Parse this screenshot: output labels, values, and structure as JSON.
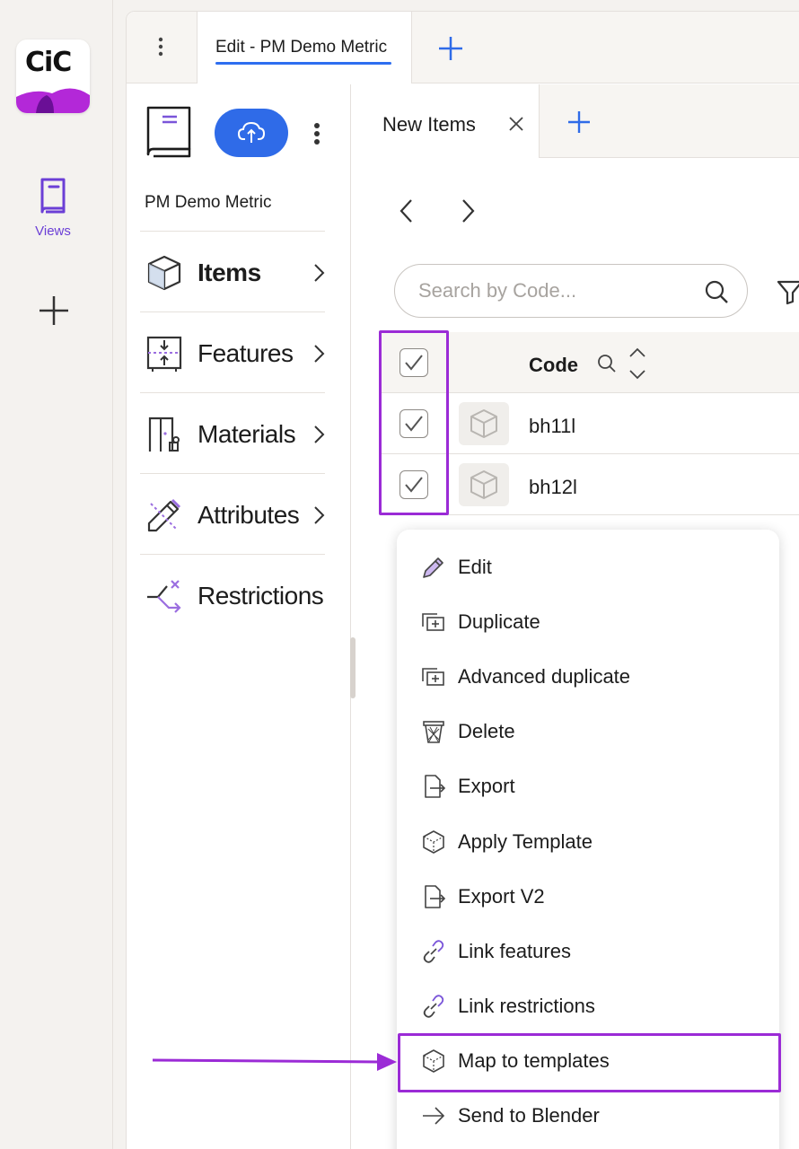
{
  "app": {
    "logo_text": "CiC",
    "rail": {
      "views_label": "Views"
    }
  },
  "tabs": {
    "active_label": "Edit - PM Demo Metric"
  },
  "sidebar": {
    "model_name": "PM Demo Metric",
    "items": [
      {
        "label": "Items",
        "active": true
      },
      {
        "label": "Features"
      },
      {
        "label": "Materials"
      },
      {
        "label": "Attributes"
      },
      {
        "label": "Restrictions"
      }
    ]
  },
  "content": {
    "tab_label": "New Items",
    "search_placeholder": "Search by Code...",
    "table": {
      "column_code": "Code",
      "rows": [
        {
          "code": "bh11l",
          "checked": true
        },
        {
          "code": "bh12l",
          "checked": true
        }
      ],
      "header_checked": true
    }
  },
  "context_menu": {
    "items": [
      {
        "label": "Edit",
        "icon": "pencil-icon"
      },
      {
        "label": "Duplicate",
        "icon": "duplicate-icon"
      },
      {
        "label": "Advanced duplicate",
        "icon": "duplicate-icon"
      },
      {
        "label": "Delete",
        "icon": "trash-icon"
      },
      {
        "label": "Export",
        "icon": "export-icon"
      },
      {
        "label": "Apply Template",
        "icon": "cube-icon"
      },
      {
        "label": "Export V2",
        "icon": "export-icon"
      },
      {
        "label": "Link features",
        "icon": "link-icon"
      },
      {
        "label": "Link restrictions",
        "icon": "link-icon"
      },
      {
        "label": "Map to templates",
        "icon": "cube-icon",
        "highlighted": true
      },
      {
        "label": "Send to Blender",
        "icon": "arrow-right-icon"
      }
    ]
  },
  "colors": {
    "accent_blue": "#2f6be8",
    "highlight_purple": "#9b2bd6",
    "views_purple": "#6b3fd6"
  }
}
